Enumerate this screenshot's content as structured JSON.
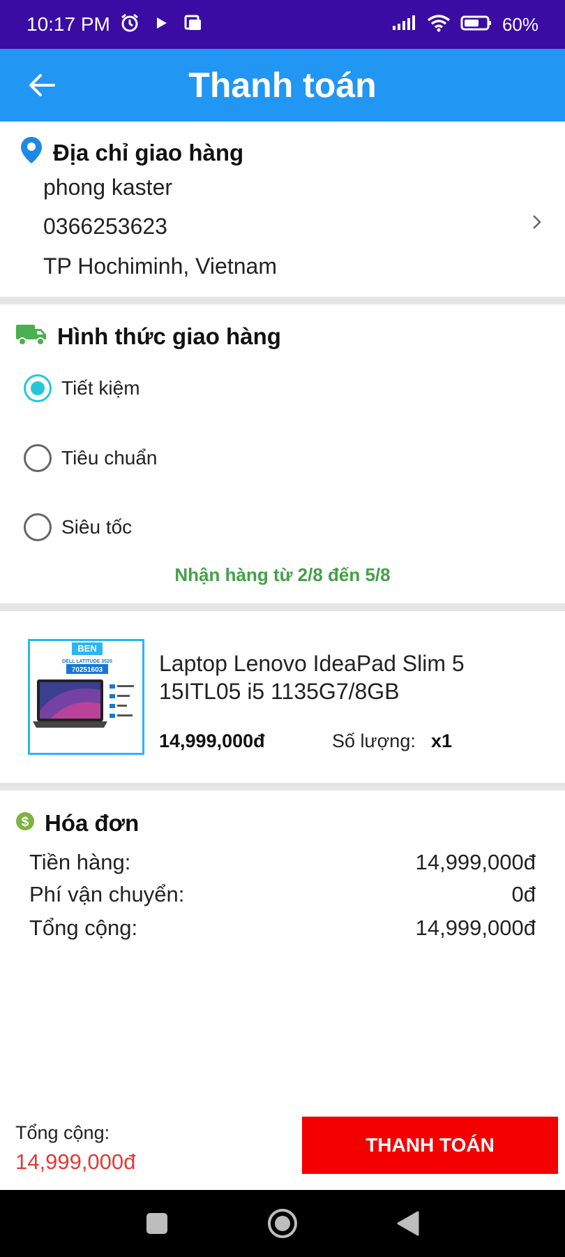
{
  "status_bar": {
    "time": "10:17 PM",
    "battery": "60%"
  },
  "header": {
    "title": "Thanh toán"
  },
  "address": {
    "heading": "Địa chỉ giao hàng",
    "name": "phong kaster",
    "phone": "0366253623",
    "location": "TP Hochiminh, Vietnam"
  },
  "shipping": {
    "heading": "Hình thức giao hàng",
    "options": [
      {
        "label": "Tiết kiệm",
        "selected": true
      },
      {
        "label": "Tiêu chuẩn",
        "selected": false
      },
      {
        "label": "Siêu tốc",
        "selected": false
      }
    ],
    "delivery_note": "Nhận hàng từ 2/8 đến 5/8"
  },
  "product": {
    "image_brand": "BEN",
    "image_model": "DELL LATITUDE 3520",
    "image_code": "70251603",
    "name": "Laptop Lenovo IdeaPad Slim 5 15ITL05 i5 1135G7/8GB",
    "price": "14,999,000đ",
    "quantity_label": "Số lượng:",
    "quantity_value": "x1"
  },
  "invoice": {
    "heading": "Hóa đơn",
    "rows": [
      {
        "label": "Tiền hàng:",
        "value": "14,999,000đ"
      },
      {
        "label": "Phí vận chuyển:",
        "value": "0đ"
      },
      {
        "label": "Tổng cộng:",
        "value": "14,999,000đ"
      }
    ]
  },
  "footer": {
    "total_label": "Tổng cộng:",
    "total_value": "14,999,000đ",
    "pay_button": "THANH TOÁN"
  },
  "colors": {
    "status_bar": "#3a0ca3",
    "app_bar": "#2196f3",
    "radio_selected": "#26c6da",
    "delivery_note": "#43a047",
    "pay_button": "#f40000",
    "total_value": "#e53935"
  }
}
